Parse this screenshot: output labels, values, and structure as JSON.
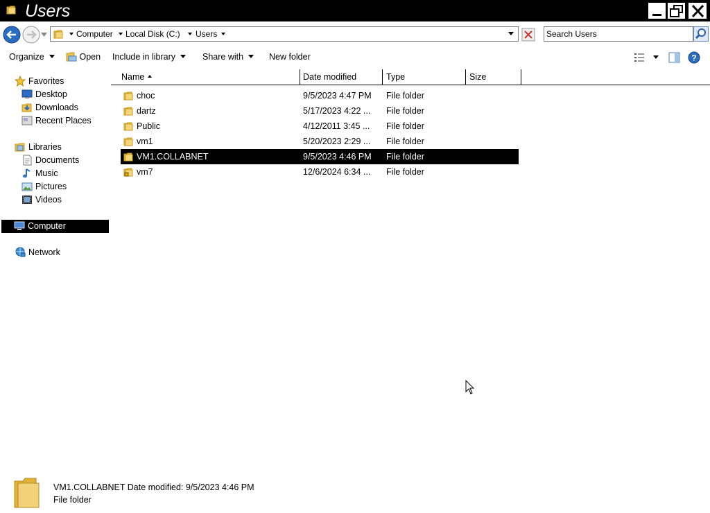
{
  "window": {
    "title": "Users"
  },
  "address": {
    "crumbs": [
      "Computer",
      "Local Disk (C:)",
      "Users"
    ],
    "search_placeholder": "Search Users"
  },
  "commands": {
    "organize": "Organize",
    "open": "Open",
    "include_in_library": "Include in library",
    "share_with": "Share with",
    "new_folder": "New folder"
  },
  "nav": {
    "favorites": "Favorites",
    "desktop": "Desktop",
    "downloads": "Downloads",
    "recent_places": "Recent Places",
    "libraries": "Libraries",
    "documents": "Documents",
    "music": "Music",
    "pictures": "Pictures",
    "videos": "Videos",
    "computer": "Computer",
    "network": "Network"
  },
  "columns": {
    "name": "Name",
    "date_modified": "Date modified",
    "type": "Type",
    "size": "Size"
  },
  "files": [
    {
      "name": "choc",
      "date": "9/5/2023 4:47 PM",
      "type": "File folder"
    },
    {
      "name": "dartz",
      "date": "5/17/2023 4:22 ...",
      "type": "File folder"
    },
    {
      "name": "Public",
      "date": "4/12/2011 3:45 ...",
      "type": "File folder"
    },
    {
      "name": "vm1",
      "date": "5/20/2023 2:29 ...",
      "type": "File folder"
    },
    {
      "name": "VM1.COLLABNET",
      "date": "9/5/2023 4:46 PM",
      "type": "File folder"
    },
    {
      "name": "vm7",
      "date": "12/6/2024 6:34 ...",
      "type": "File folder"
    }
  ],
  "details": {
    "name": "VM1.COLLABNET",
    "date_label": "Date modified:",
    "date_value": "9/5/2023 4:46 PM",
    "type": "File folder"
  },
  "colors": {
    "folder": "#e8c04a",
    "folder_dark": "#c99a1e",
    "selection": "#000000"
  },
  "icons": [
    "folder-icon",
    "back-arrow-icon",
    "forward-arrow-icon",
    "search-icon",
    "help-icon",
    "star-icon",
    "computer-icon",
    "network-icon"
  ]
}
